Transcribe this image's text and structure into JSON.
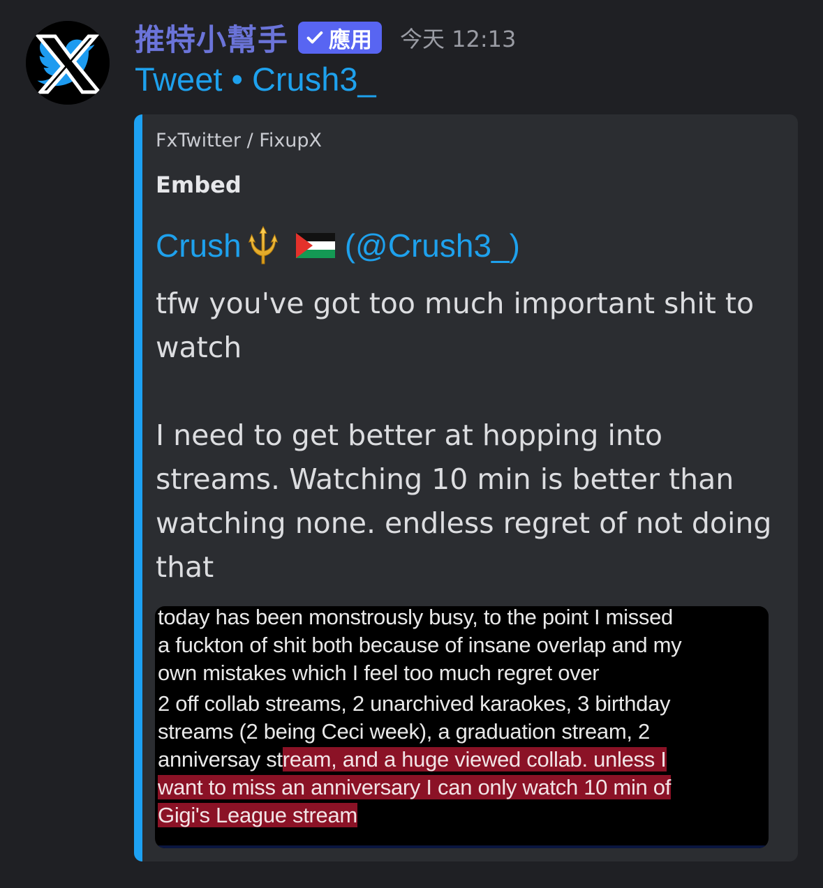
{
  "message": {
    "username": "推特小幫手",
    "badge_label": "應用",
    "timestamp": "今天 12:13",
    "subtitle": "Tweet • Crush3_",
    "avatar_icon": "x-twitter-logo-icon"
  },
  "embed": {
    "provider": "FxTwitter / FixupX",
    "title": "Embed",
    "author_name": "Crush",
    "author_handle": "(@Crush3_)",
    "author_emojis": [
      "trident-icon",
      "palestine-flag-icon"
    ],
    "text": "tfw you've got too much important shit to watch\n\nI need to get better at hopping into streams. Watching 10 min is better than watching none. endless regret of not doing that",
    "accent_color": "#1da1f2",
    "image": {
      "paragraph1": [
        "today has been monstrously busy, to the point I missed",
        "a fuckton of shit both because of insane overlap and my",
        "own mistakes which I feel too much regret over"
      ],
      "paragraph2_line1": "2 off collab streams, 2 unarchived karaokes, 3 birthday",
      "paragraph2_line2": "streams (2 being Ceci week), a graduation stream, 2",
      "paragraph2_line3_plain": "anniversay st",
      "paragraph2_line3_highlight": "ream,  and a huge viewed collab. unless I",
      "paragraph2_line4_highlight": "want to miss an anniversary I can only watch 10 min of",
      "paragraph2_line5_highlight": "Gigi's League stream",
      "highlight_color": "#8b1226"
    }
  }
}
